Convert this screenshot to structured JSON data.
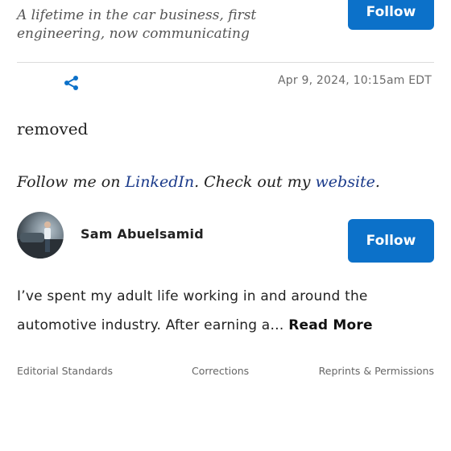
{
  "author_header": {
    "tagline": "A lifetime in the car business, first engineering, now communicating",
    "follow_label": "Follow"
  },
  "meta": {
    "share_icon": "share-icon",
    "timestamp": "Apr 9, 2024, 10:15am EDT"
  },
  "article": {
    "body_text": "removed",
    "follow_prefix": "Follow me on ",
    "linkedin_label": "LinkedIn",
    "mid_text": ". Check out  my ",
    "website_label": "website",
    "end_text": "."
  },
  "author_card": {
    "name": "Sam Abuelsamid",
    "follow_label": "Follow",
    "bio_line1": "I’ve spent my adult life working in and around the",
    "bio_line2": "automotive industry. After earning a… ",
    "read_more": "Read More"
  },
  "footer": {
    "links": [
      "Editorial Standards",
      "Corrections",
      "Reprints & Permissions"
    ]
  },
  "colors": {
    "accent": "#0c71c9",
    "link": "#1a3a8a",
    "muted": "#6b6b6b"
  }
}
